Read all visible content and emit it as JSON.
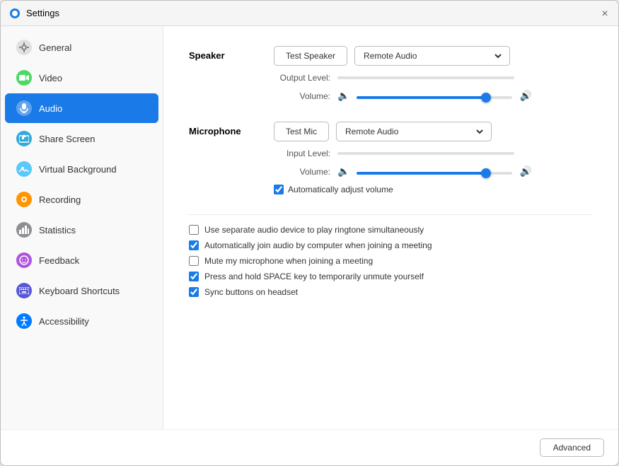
{
  "window": {
    "title": "Settings",
    "close_label": "×"
  },
  "sidebar": {
    "items": [
      {
        "id": "general",
        "label": "General",
        "icon": "⚙",
        "icon_class": "icon-general",
        "active": false
      },
      {
        "id": "video",
        "label": "Video",
        "icon": "▶",
        "icon_class": "icon-video",
        "active": false
      },
      {
        "id": "audio",
        "label": "Audio",
        "icon": "♪",
        "icon_class": "icon-audio",
        "active": true
      },
      {
        "id": "share-screen",
        "label": "Share Screen",
        "icon": "⬆",
        "icon_class": "icon-share",
        "active": false
      },
      {
        "id": "virtual-background",
        "label": "Virtual Background",
        "icon": "★",
        "icon_class": "icon-vbg",
        "active": false
      },
      {
        "id": "recording",
        "label": "Recording",
        "icon": "●",
        "icon_class": "icon-recording",
        "active": false
      },
      {
        "id": "statistics",
        "label": "Statistics",
        "icon": "📊",
        "icon_class": "icon-stats",
        "active": false
      },
      {
        "id": "feedback",
        "label": "Feedback",
        "icon": "☺",
        "icon_class": "icon-feedback",
        "active": false
      },
      {
        "id": "keyboard-shortcuts",
        "label": "Keyboard Shortcuts",
        "icon": "⌨",
        "icon_class": "icon-keyboard",
        "active": false
      },
      {
        "id": "accessibility",
        "label": "Accessibility",
        "icon": "♿",
        "icon_class": "icon-access",
        "active": false
      }
    ]
  },
  "main": {
    "speaker": {
      "label": "Speaker",
      "test_button": "Test Speaker",
      "output_level_label": "Output Level:",
      "volume_label": "Volume:",
      "dropdown_value": "Remote Audio",
      "volume_value": 85
    },
    "microphone": {
      "label": "Microphone",
      "test_button": "Test Mic",
      "input_level_label": "Input Level:",
      "volume_label": "Volume:",
      "dropdown_value": "Remote Audio",
      "volume_value": 85,
      "auto_adjust_label": "Automatically adjust volume",
      "auto_adjust_checked": true
    },
    "options": [
      {
        "id": "separate-audio",
        "label": "Use separate audio device to play ringtone simultaneously",
        "checked": false
      },
      {
        "id": "auto-join",
        "label": "Automatically join audio by computer when joining a meeting",
        "checked": true
      },
      {
        "id": "mute-join",
        "label": "Mute my microphone when joining a meeting",
        "checked": false
      },
      {
        "id": "spacebar",
        "label": "Press and hold SPACE key to temporarily unmute yourself",
        "checked": true
      },
      {
        "id": "sync-buttons",
        "label": "Sync buttons on headset",
        "checked": true
      }
    ],
    "advanced_button": "Advanced"
  }
}
